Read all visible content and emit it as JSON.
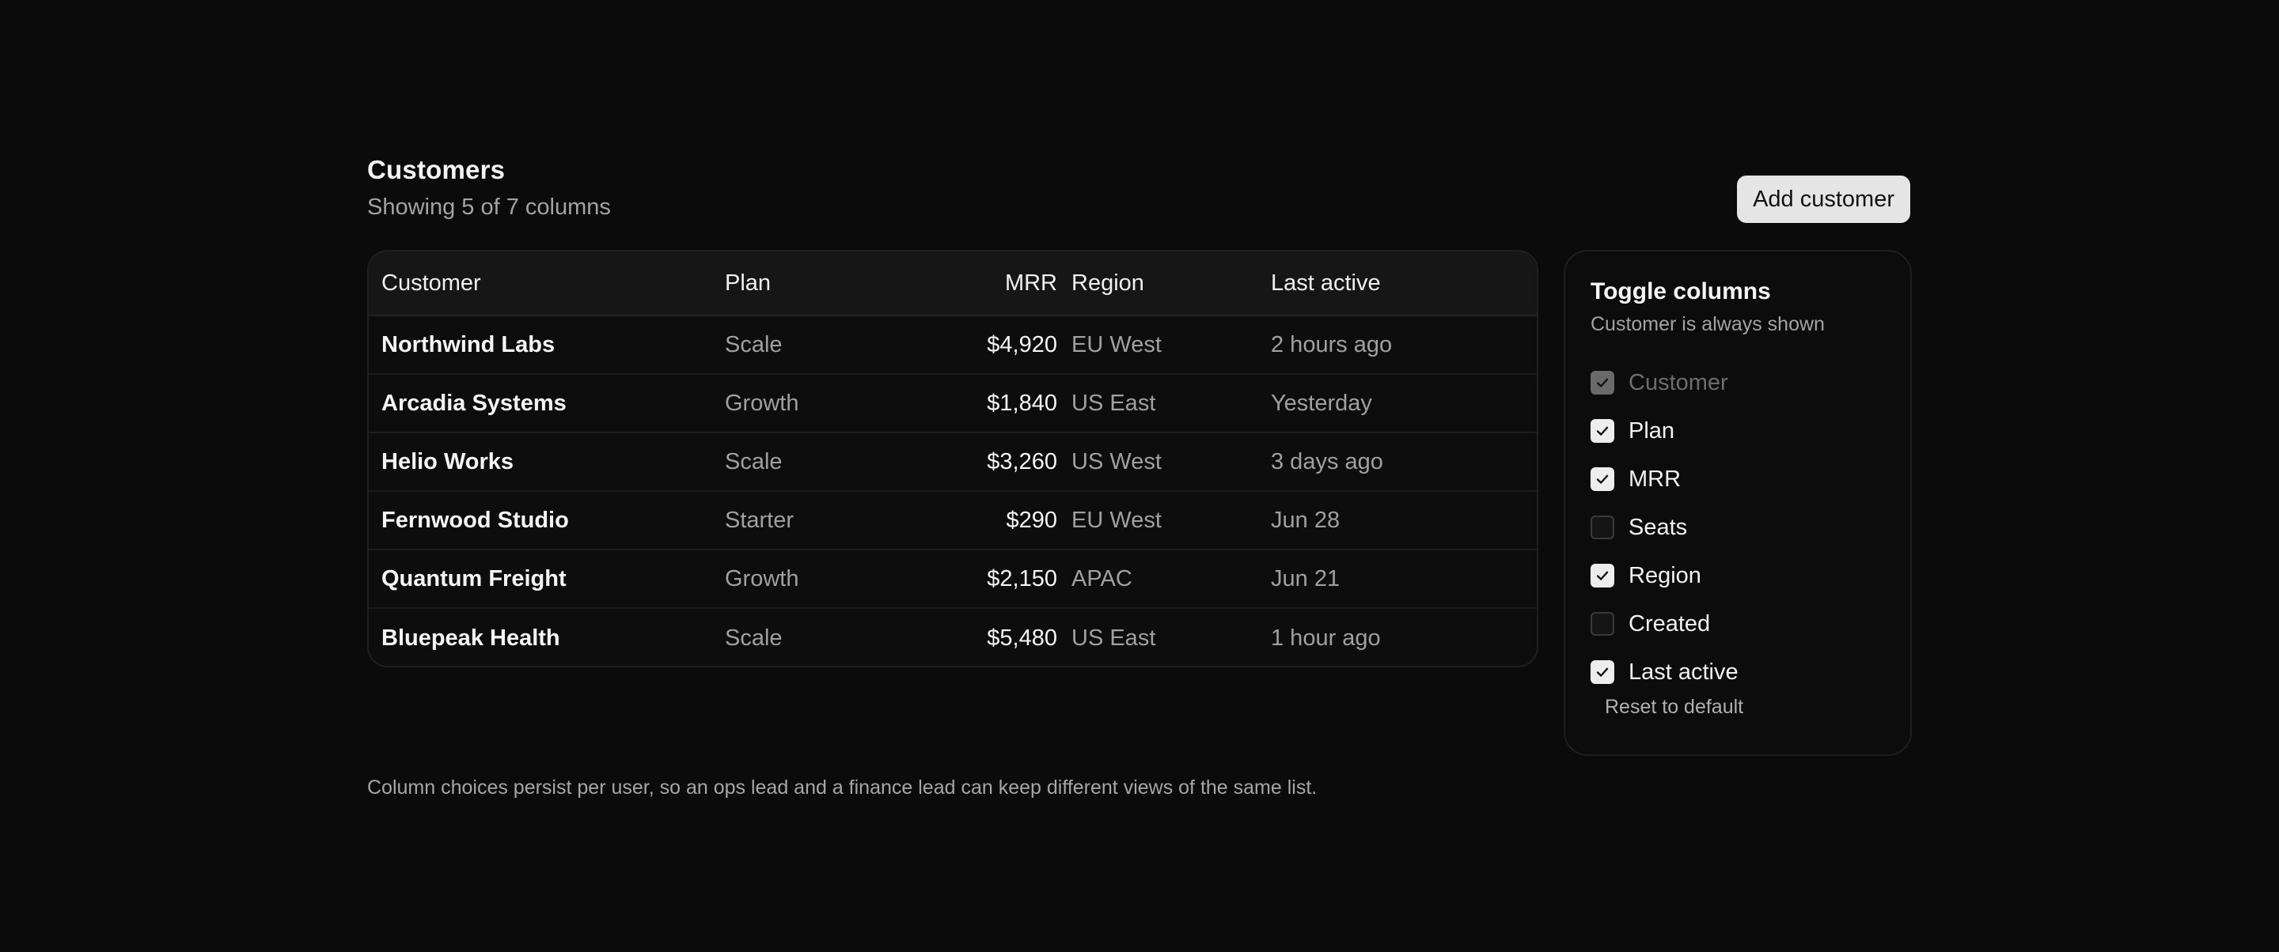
{
  "header": {
    "title": "Customers",
    "subtitle": "Showing 5 of 7 columns",
    "add_button": "Add customer"
  },
  "table": {
    "columns": [
      "Customer",
      "Plan",
      "MRR",
      "Region",
      "Last active"
    ],
    "rows": [
      {
        "customer": "Northwind Labs",
        "plan": "Scale",
        "mrr": "$4,920",
        "region": "EU West",
        "last_active": "2 hours ago"
      },
      {
        "customer": "Arcadia Systems",
        "plan": "Growth",
        "mrr": "$1,840",
        "region": "US East",
        "last_active": "Yesterday"
      },
      {
        "customer": "Helio Works",
        "plan": "Scale",
        "mrr": "$3,260",
        "region": "US West",
        "last_active": "3 days ago"
      },
      {
        "customer": "Fernwood Studio",
        "plan": "Starter",
        "mrr": "$290",
        "region": "EU West",
        "last_active": "Jun 28"
      },
      {
        "customer": "Quantum Freight",
        "plan": "Growth",
        "mrr": "$2,150",
        "region": "APAC",
        "last_active": "Jun 21"
      },
      {
        "customer": "Bluepeak Health",
        "plan": "Scale",
        "mrr": "$5,480",
        "region": "US East",
        "last_active": "1 hour ago"
      }
    ]
  },
  "toggle_panel": {
    "title": "Toggle columns",
    "subtitle": "Customer is always shown",
    "options": [
      {
        "label": "Customer",
        "checked": true,
        "disabled": true
      },
      {
        "label": "Plan",
        "checked": true,
        "disabled": false
      },
      {
        "label": "MRR",
        "checked": true,
        "disabled": false
      },
      {
        "label": "Seats",
        "checked": false,
        "disabled": false
      },
      {
        "label": "Region",
        "checked": true,
        "disabled": false
      },
      {
        "label": "Created",
        "checked": false,
        "disabled": false
      },
      {
        "label": "Last active",
        "checked": true,
        "disabled": false
      }
    ],
    "reset_label": "Reset to default"
  },
  "footnote": "Column choices persist per user, so an ops lead and a finance lead can keep different views of the same list.",
  "colors": {
    "background": "#0b0b0b",
    "button_bg": "#e5e5e5",
    "checkbox_on": "#ededed",
    "checkbox_disabled": "#6a6a6a",
    "muted_text": "#a3a3a3"
  },
  "icons": {
    "check": "check-icon"
  }
}
